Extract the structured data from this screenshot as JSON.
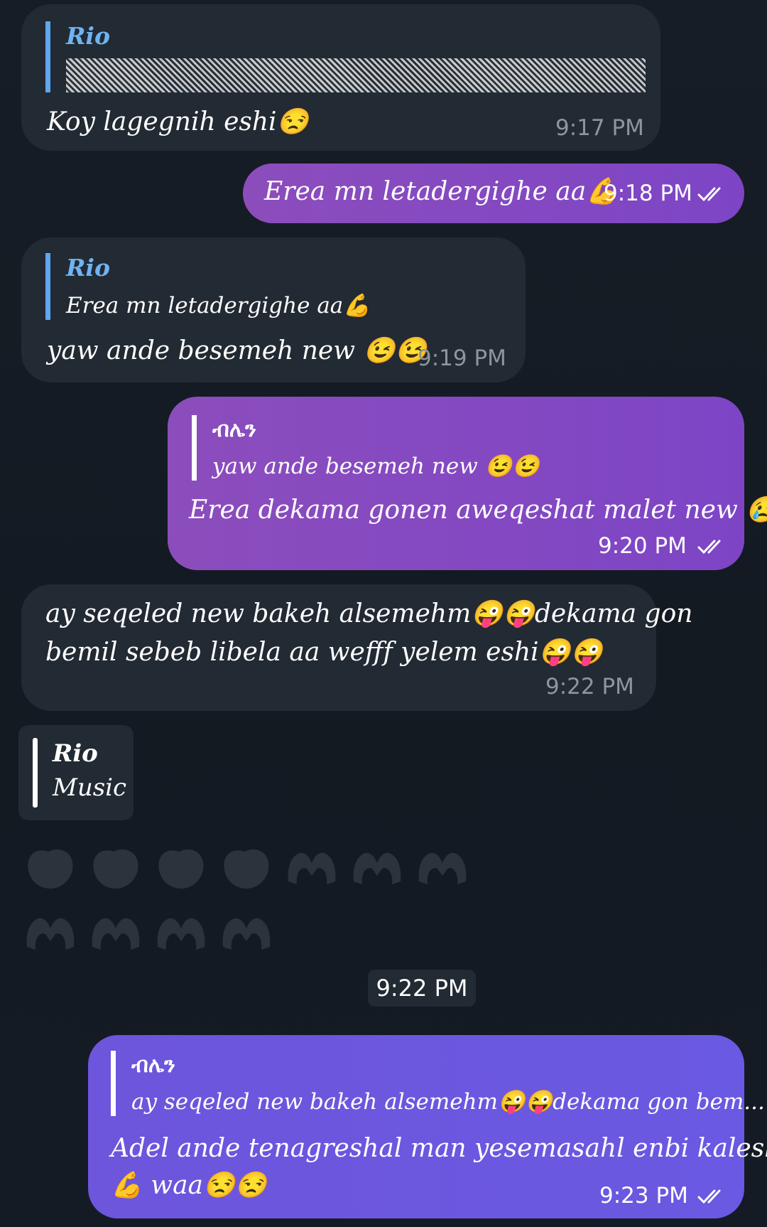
{
  "messages": [
    {
      "id": "m1",
      "direction": "incoming",
      "reply": {
        "name": "Rio",
        "text": ""
      },
      "text": "Koy lagegnih eshi😒",
      "time": "9:17 PM"
    },
    {
      "id": "m2",
      "direction": "outgoing",
      "text": "Erea mn letadergighe aa💪",
      "time": "9:18 PM",
      "status": "read"
    },
    {
      "id": "m3",
      "direction": "incoming",
      "reply": {
        "name": "Rio",
        "text": "Erea mn letadergighe aa💪"
      },
      "text": "yaw ande besemeh new 😉😉",
      "time": "9:19 PM"
    },
    {
      "id": "m4",
      "direction": "outgoing",
      "reply": {
        "name": "ብሌን",
        "text": "yaw ande besemeh new 😉😉"
      },
      "text": "Erea dekama gonen aweqeshat malet new 😢",
      "time": "9:20 PM",
      "status": "read"
    },
    {
      "id": "m5",
      "direction": "incoming",
      "lines": [
        "ay seqeled new bakeh alsemehm😜😜dekama gon",
        "bemil sebeb libela aa wefff yelem eshi😜😜"
      ],
      "time": "9:22 PM"
    },
    {
      "id": "m6",
      "direction": "incoming",
      "music": {
        "name": "Rio",
        "subtitle": "Music"
      },
      "reaction_emoji_count": 11
    },
    {
      "id": "m7",
      "direction": "outgoing",
      "reply": {
        "name": "ብሌን",
        "text": "ay seqeled new bakeh alsemehm😜😜dekama gon bem..."
      },
      "lines": [
        "Adel ande tenagreshal man yesemasahl enbi kalesh",
        "💪 waa😒😒"
      ],
      "time": "9:23 PM",
      "status": "read"
    }
  ],
  "date_chip": "9:22 PM",
  "colors": {
    "incoming_bubble": "#222a33",
    "outgoing_purple": "#8447c0",
    "outgoing_violet": "#6c57df",
    "reply_accent": "#60a7ee",
    "timestamp_incoming": "#8e959d"
  },
  "icons": {
    "read_receipt": "double-check-icon",
    "reaction": "heart-hands-icon"
  }
}
